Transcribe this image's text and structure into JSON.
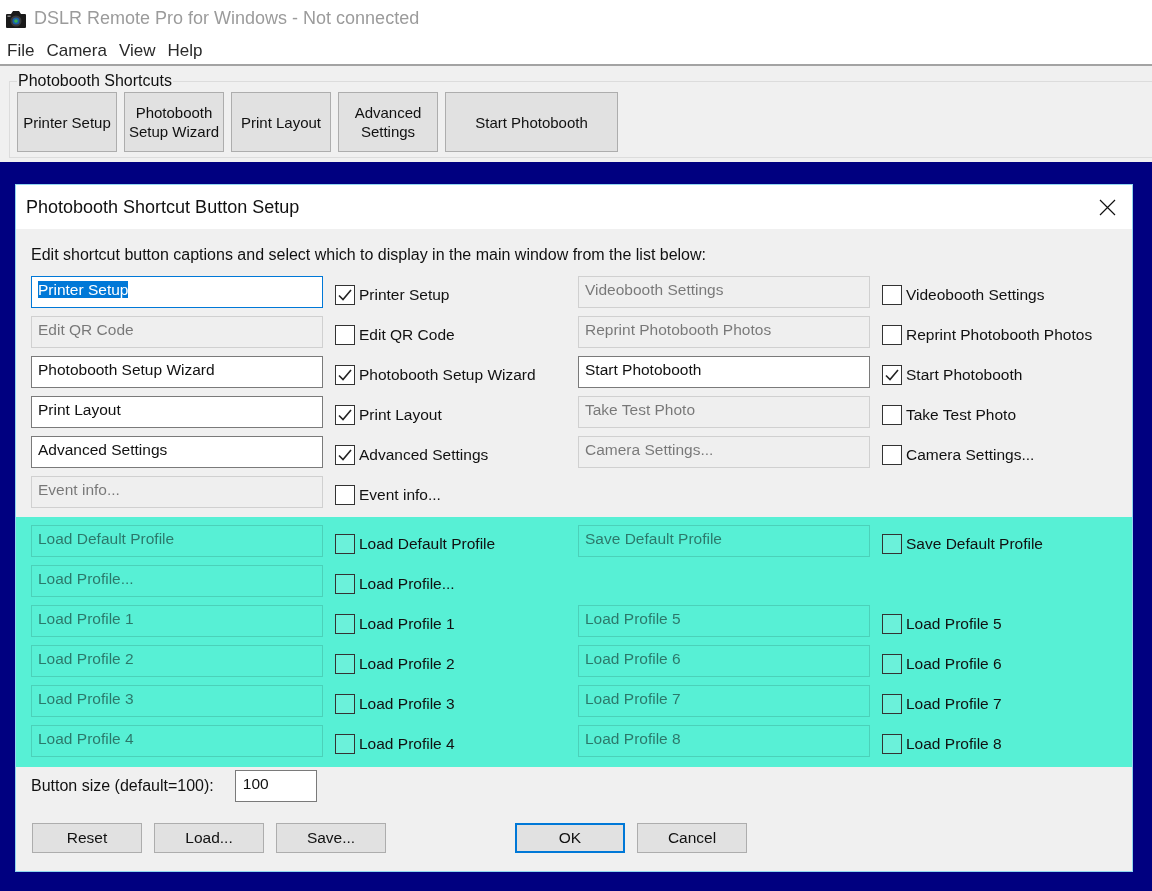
{
  "window": {
    "title": "DSLR Remote Pro for Windows - Not connected"
  },
  "menu": [
    "File",
    "Camera",
    "View",
    "Help"
  ],
  "toolbar": {
    "group_title": "Photobooth Shortcuts",
    "buttons": [
      "Printer Setup",
      "Photobooth Setup Wizard",
      "Print Layout",
      "Advanced Settings",
      "Start Photobooth"
    ]
  },
  "dialog": {
    "title": "Photobooth Shortcut Button Setup",
    "instructions": "Edit shortcut button captions and select which to display in the main window from the list below:",
    "sections": [
      {
        "kind": "standard",
        "rows": [
          {
            "left": {
              "caption": "Printer Setup",
              "label": "Printer Setup",
              "checked": true,
              "disabled": false,
              "focused": true
            },
            "right": {
              "caption": "Videobooth Settings",
              "label": "Videobooth Settings",
              "checked": false,
              "disabled": true,
              "focused": false
            }
          },
          {
            "left": {
              "caption": "Edit QR Code",
              "label": "Edit QR Code",
              "checked": false,
              "disabled": true,
              "focused": false
            },
            "right": {
              "caption": "Reprint Photobooth Photos",
              "label": "Reprint Photobooth Photos",
              "checked": false,
              "disabled": true,
              "focused": false
            }
          },
          {
            "left": {
              "caption": "Photobooth Setup Wizard",
              "label": "Photobooth Setup Wizard",
              "checked": true,
              "disabled": false,
              "focused": false
            },
            "right": {
              "caption": "Start Photobooth",
              "label": "Start Photobooth",
              "checked": true,
              "disabled": false,
              "focused": false
            }
          },
          {
            "left": {
              "caption": "Print Layout",
              "label": "Print Layout",
              "checked": true,
              "disabled": false,
              "focused": false
            },
            "right": {
              "caption": "Take Test Photo",
              "label": "Take Test Photo",
              "checked": false,
              "disabled": true,
              "focused": false
            }
          },
          {
            "left": {
              "caption": "Advanced Settings",
              "label": "Advanced Settings",
              "checked": true,
              "disabled": false,
              "focused": false
            },
            "right": {
              "caption": "Camera Settings...",
              "label": "Camera Settings...",
              "checked": false,
              "disabled": true,
              "focused": false
            }
          },
          {
            "left": {
              "caption": "Event info...",
              "label": "Event info...",
              "checked": false,
              "disabled": true,
              "focused": false
            }
          }
        ]
      },
      {
        "kind": "profiles",
        "rows": [
          {
            "left": {
              "caption": "Load Default Profile",
              "label": "Load Default Profile",
              "checked": false,
              "disabled": true,
              "focused": false
            },
            "right": {
              "caption": "Save Default Profile",
              "label": "Save Default Profile",
              "checked": false,
              "disabled": true,
              "focused": false
            }
          },
          {
            "left": {
              "caption": "Load Profile...",
              "label": "Load Profile...",
              "checked": false,
              "disabled": true,
              "focused": false
            }
          },
          {
            "left": {
              "caption": "Load Profile 1",
              "label": "Load Profile 1",
              "checked": false,
              "disabled": true,
              "focused": false
            },
            "right": {
              "caption": "Load Profile 5",
              "label": "Load Profile 5",
              "checked": false,
              "disabled": true,
              "focused": false
            }
          },
          {
            "left": {
              "caption": "Load Profile 2",
              "label": "Load Profile 2",
              "checked": false,
              "disabled": true,
              "focused": false
            },
            "right": {
              "caption": "Load Profile 6",
              "label": "Load Profile 6",
              "checked": false,
              "disabled": true,
              "focused": false
            }
          },
          {
            "left": {
              "caption": "Load Profile 3",
              "label": "Load Profile 3",
              "checked": false,
              "disabled": true,
              "focused": false
            },
            "right": {
              "caption": "Load Profile 7",
              "label": "Load Profile 7",
              "checked": false,
              "disabled": true,
              "focused": false
            }
          },
          {
            "left": {
              "caption": "Load Profile 4",
              "label": "Load Profile 4",
              "checked": false,
              "disabled": true,
              "focused": false
            },
            "right": {
              "caption": "Load Profile 8",
              "label": "Load Profile 8",
              "checked": false,
              "disabled": true,
              "focused": false
            }
          }
        ]
      }
    ],
    "size_label": "Button size (default=100):",
    "size_value": "100",
    "left_buttons": [
      "Reset",
      "Load...",
      "Save..."
    ],
    "right_buttons": [
      {
        "label": "OK",
        "default": true
      },
      {
        "label": "Cancel",
        "default": false
      }
    ]
  }
}
